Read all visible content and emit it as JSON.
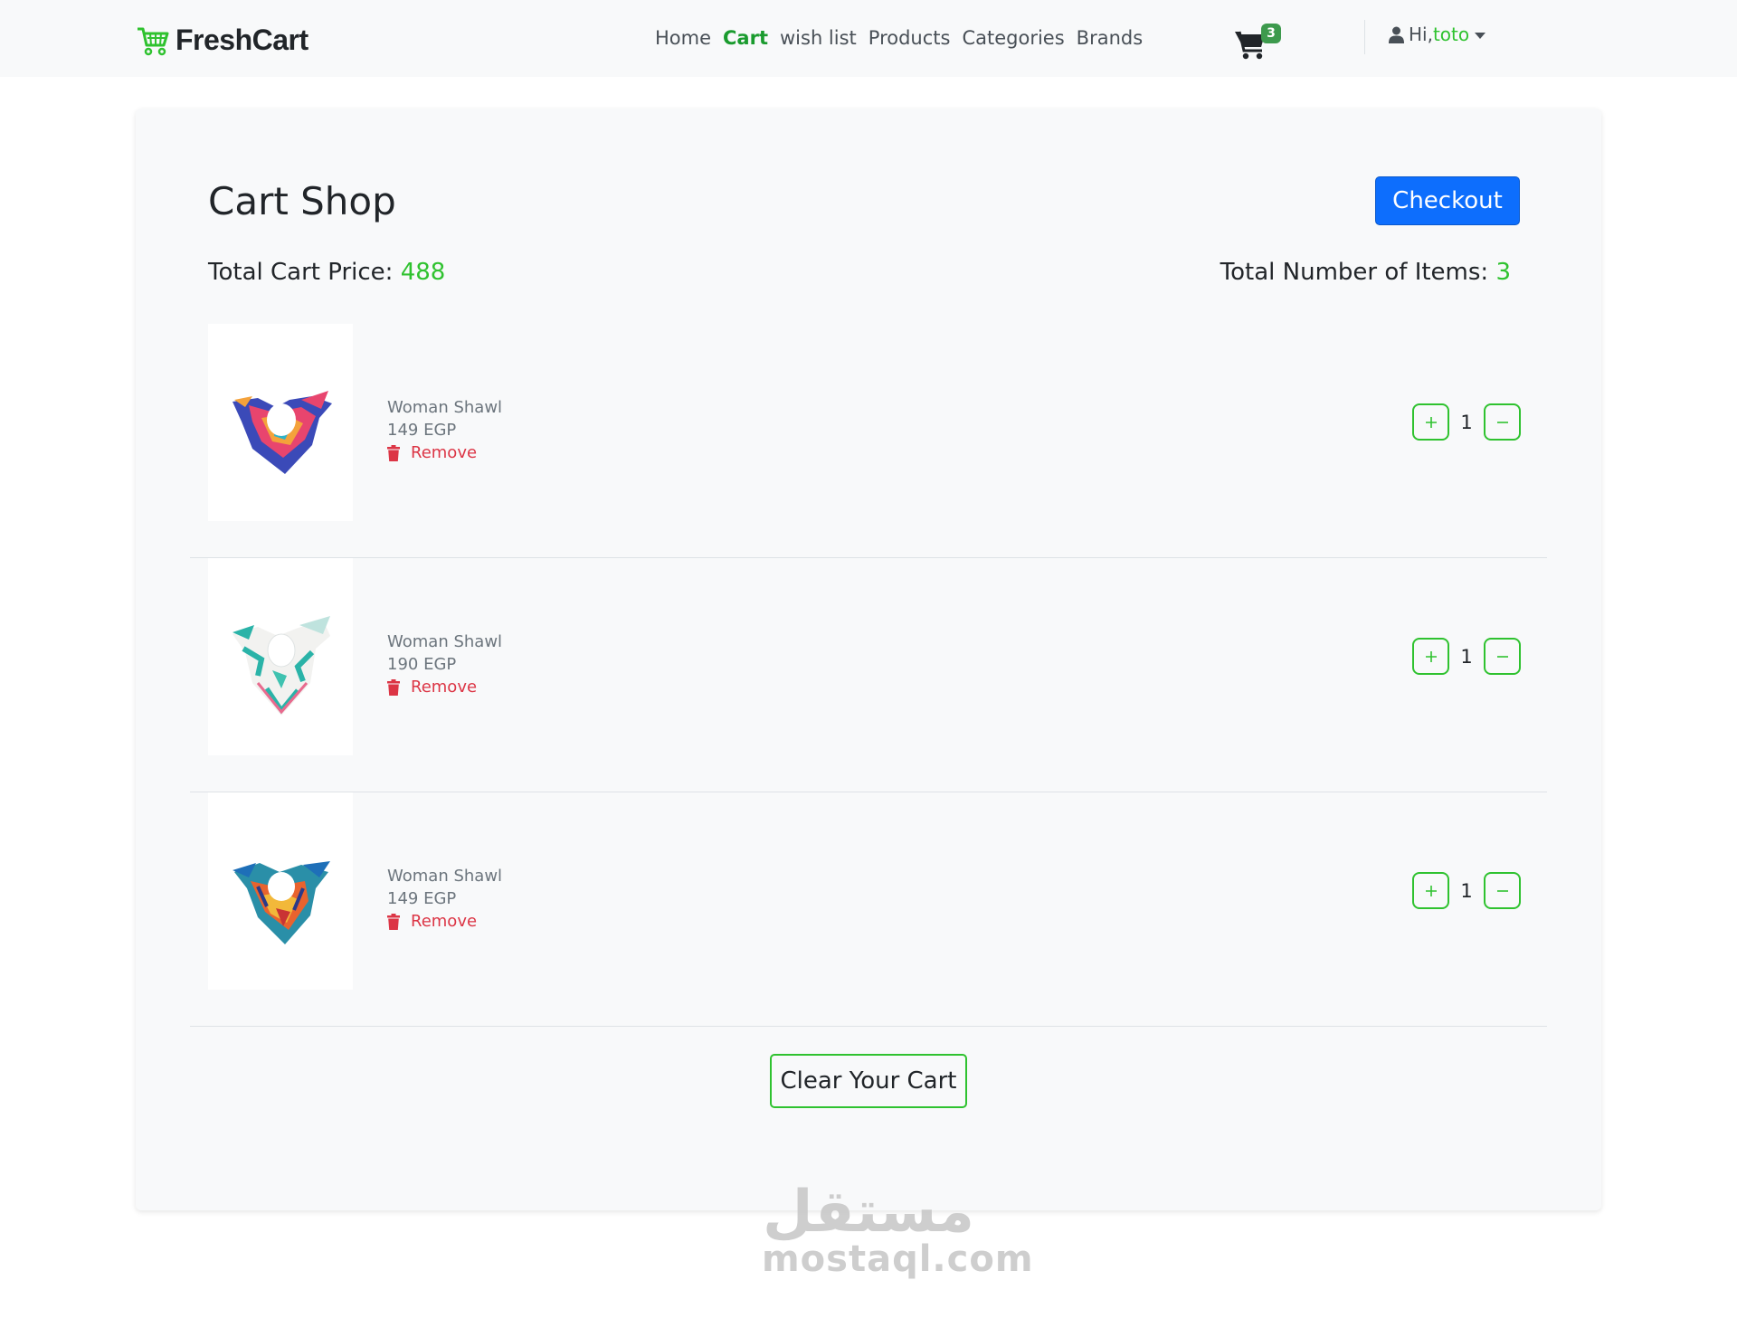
{
  "navbar": {
    "brand": "FreshCart",
    "links": [
      {
        "label": "Home",
        "active": false
      },
      {
        "label": "Cart",
        "active": true
      },
      {
        "label": "wish list",
        "active": false
      },
      {
        "label": "Products",
        "active": false
      },
      {
        "label": "Categories",
        "active": false
      },
      {
        "label": "Brands",
        "active": false
      }
    ],
    "cart_count": "3",
    "greeting": "Hi,",
    "username": "toto"
  },
  "cart": {
    "title": "Cart Shop",
    "checkout_label": "Checkout",
    "total_price_label": "Total Cart Price:",
    "total_price": "488",
    "total_items_label": "Total Number of Items:",
    "total_items": "3",
    "items": [
      {
        "name": "Woman Shawl",
        "price": "149 EGP",
        "remove_label": "Remove",
        "quantity": "1"
      },
      {
        "name": "Woman Shawl",
        "price": "190 EGP",
        "remove_label": "Remove",
        "quantity": "1"
      },
      {
        "name": "Woman Shawl",
        "price": "149 EGP",
        "remove_label": "Remove",
        "quantity": "1"
      }
    ],
    "clear_label": "Clear Your Cart"
  },
  "watermark": {
    "arabic": "مستقل",
    "latin": "mostaql.com"
  },
  "colors": {
    "accent_green": "#2fc22f",
    "brand_green": "#1a9b2e",
    "primary_blue": "#0d6efd",
    "danger_red": "#dc3545"
  }
}
